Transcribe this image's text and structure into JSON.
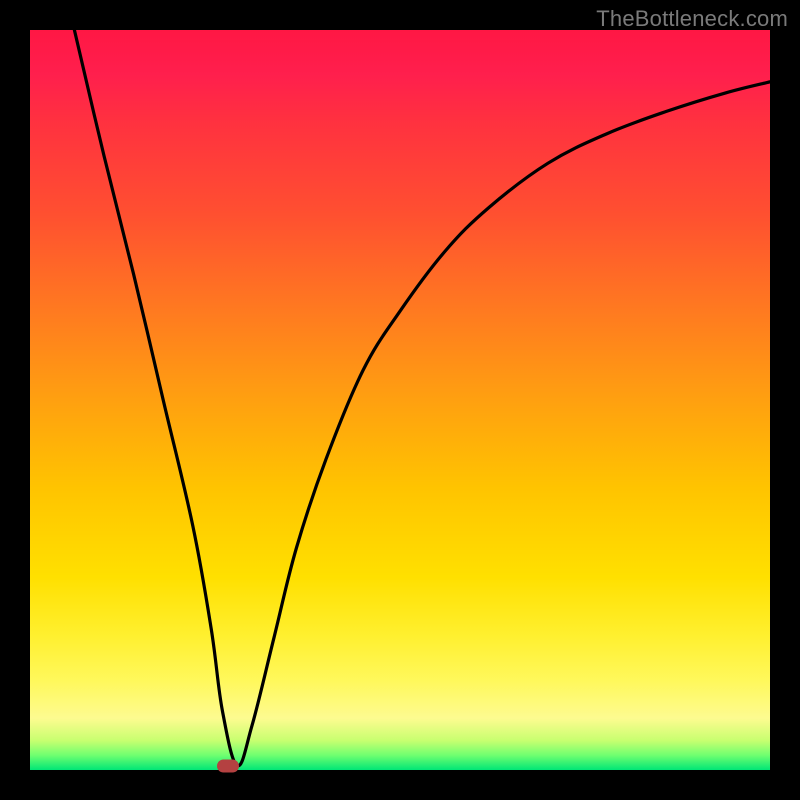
{
  "watermark": "TheBottleneck.com",
  "chart_data": {
    "type": "line",
    "title": "",
    "xlabel": "",
    "ylabel": "",
    "xlim": [
      0,
      100
    ],
    "ylim": [
      0,
      100
    ],
    "grid": false,
    "series": [
      {
        "name": "curve",
        "x": [
          6,
          10,
          14,
          18,
          22,
          24.5,
          26,
          28,
          30,
          33,
          36,
          40,
          45,
          50,
          56,
          62,
          70,
          78,
          86,
          94,
          100
        ],
        "y": [
          100,
          83,
          67,
          50,
          33,
          19,
          8,
          0.6,
          6,
          18,
          30,
          42,
          54,
          62,
          70,
          76,
          82,
          86,
          89,
          91.5,
          93
        ]
      }
    ],
    "marker": {
      "x": 26.8,
      "y": 0.6
    },
    "gradient_colors": {
      "top": "#ff1744",
      "mid": "#ffc400",
      "bottom": "#00e676"
    }
  }
}
